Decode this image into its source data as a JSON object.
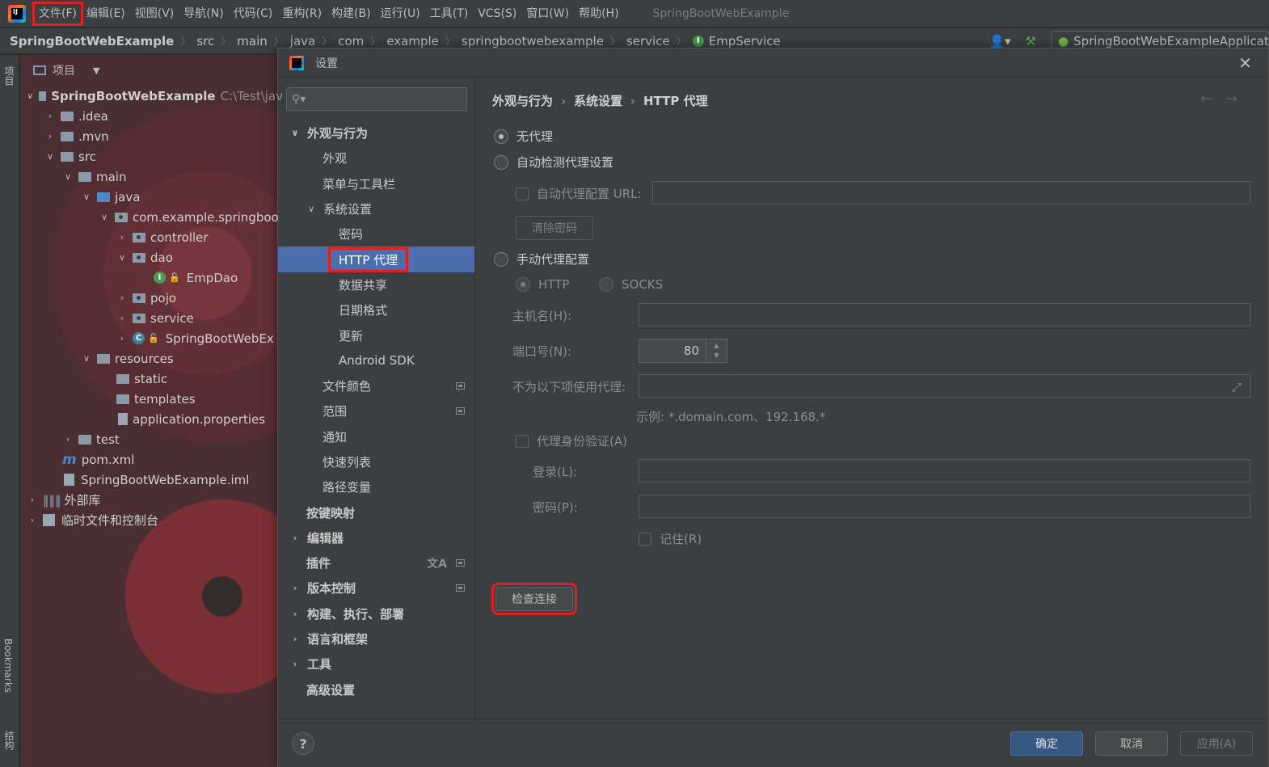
{
  "app": {
    "logo_text": "IJ",
    "menu": [
      "文件(F)",
      "编辑(E)",
      "视图(V)",
      "导航(N)",
      "代码(C)",
      "重构(R)",
      "构建(B)",
      "运行(U)",
      "工具(T)",
      "VCS(S)",
      "窗口(W)",
      "帮助(H)"
    ],
    "window_title": "SpringBootWebExample"
  },
  "breadcrumb": {
    "items": [
      "SpringBootWebExample",
      "src",
      "main",
      "java",
      "com",
      "example",
      "springbootwebexample",
      "service"
    ],
    "current_icon": "I",
    "current": "EmpService",
    "run_config": "SpringBootWebExampleApplicat"
  },
  "toolstrip": {
    "project": "项目",
    "bookmarks": "Bookmarks",
    "structure": "结构"
  },
  "project": {
    "header": "项目",
    "tree": [
      {
        "label": "SpringBootWebExample",
        "extra": "C:\\Test\\jav",
        "bold": true
      },
      {
        "label": ".idea"
      },
      {
        "label": ".mvn"
      },
      {
        "label": "src"
      },
      {
        "label": "main"
      },
      {
        "label": "java"
      },
      {
        "label": "com.example.springboo"
      },
      {
        "label": "controller"
      },
      {
        "label": "dao"
      },
      {
        "label": "EmpDao"
      },
      {
        "label": "pojo"
      },
      {
        "label": "service"
      },
      {
        "label": "SpringBootWebEx"
      },
      {
        "label": "resources"
      },
      {
        "label": "static"
      },
      {
        "label": "templates"
      },
      {
        "label": "application.properties"
      },
      {
        "label": "test"
      },
      {
        "label": "pom.xml"
      },
      {
        "label": "SpringBootWebExample.iml"
      },
      {
        "label": "外部库"
      },
      {
        "label": "临时文件和控制台"
      }
    ]
  },
  "dialog": {
    "title": "设置",
    "search_placeholder": "",
    "nav": [
      {
        "label": "外观与行为"
      },
      {
        "label": "外观"
      },
      {
        "label": "菜单与工具栏"
      },
      {
        "label": "系统设置"
      },
      {
        "label": "密码"
      },
      {
        "label": "HTTP 代理"
      },
      {
        "label": "数据共享"
      },
      {
        "label": "日期格式"
      },
      {
        "label": "更新"
      },
      {
        "label": "Android SDK"
      },
      {
        "label": "文件颜色"
      },
      {
        "label": "范围"
      },
      {
        "label": "通知"
      },
      {
        "label": "快速列表"
      },
      {
        "label": "路径变量"
      },
      {
        "label": "按键映射"
      },
      {
        "label": "编辑器"
      },
      {
        "label": "插件"
      },
      {
        "label": "版本控制"
      },
      {
        "label": "构建、执行、部署"
      },
      {
        "label": "语言和框架"
      },
      {
        "label": "工具"
      },
      {
        "label": "高级设置"
      }
    ],
    "crumbs": [
      "外观与行为",
      "系统设置",
      "HTTP 代理"
    ],
    "proxy": {
      "no_proxy": "无代理",
      "auto_detect": "自动检测代理设置",
      "auto_url_label": "自动代理配置 URL:",
      "auto_url_value": "",
      "clear_password": "清除密码",
      "manual": "手动代理配置",
      "http": "HTTP",
      "socks": "SOCKS",
      "host_label": "主机名(H):",
      "host_value": "",
      "port_label": "端口号(N):",
      "port_value": "80",
      "no_proxy_for_label": "不为以下项使用代理:",
      "no_proxy_for_value": "",
      "example": "示例: *.domain.com、192.168.*",
      "auth_label": "代理身份验证(A)",
      "login_label": "登录(L):",
      "login_value": "",
      "password_label": "密码(P):",
      "password_value": "",
      "remember_label": "记住(R)",
      "check_connection": "检查连接",
      "selected": "no_proxy"
    },
    "help": "?",
    "ok": "确定",
    "cancel": "取消",
    "apply": "应用(A)"
  },
  "colors": {
    "accent": "#4b6eaf",
    "primary_button": "#365880",
    "highlight": "#e02020"
  }
}
